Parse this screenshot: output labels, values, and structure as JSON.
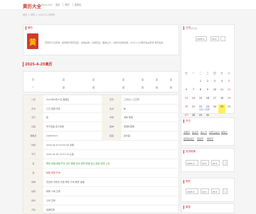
{
  "header": {
    "logo": "黄历大全",
    "logo_sub": "tlbco.com",
    "nav": [
      "首页",
      "黄历",
      "老黄历"
    ]
  },
  "breadcrumb": "首页 > 黄历 > 2025-4-25黄历",
  "intro": {
    "title": "黄历",
    "badge": "黄",
    "text": "老黄历今日查询，提供每日黄历宜忌、吉神凶煞、彭祖百忌、胎神占方、冲煞方位等内容，2025-4-25黄历吉凶查询 黄历宜忌"
  },
  "day_title": "2025-4-25黄历",
  "week_grid": {
    "row1": [
      "宜",
      "宜",
      "宜",
      "宜",
      "宜",
      "宜",
      "宜",
      "宜"
    ],
    "row2": [
      "忌",
      "忌",
      "忌",
      "忌",
      "忌",
      "忌",
      "忌",
      "忌"
    ],
    "head": [
      "日",
      "一",
      "二",
      "三",
      "四",
      "五",
      "六",
      "日"
    ]
  },
  "detail": {
    "rows": [
      {
        "label": "公历",
        "value": "2025年4月25日 星期五",
        "label2": "农历",
        "value2": "三月廿八 乙巳年"
      },
      {
        "label": "岁次",
        "value": "乙巳 庚辰 辛亥",
        "label2": "生肖",
        "value2": "蛇"
      },
      {
        "label": "五行",
        "value": "金",
        "label2": "冲煞",
        "value2": "冲蛇 煞西"
      },
      {
        "label": "彭祖",
        "value": "辛不合酱 亥不嫁娶",
        "label2": "胎神",
        "value2": "床栖外西南"
      },
      {
        "label": "儒略日",
        "value": "2460790.5",
        "label2": "星座",
        "value2": "金牛座"
      },
      {
        "label": "时辰",
        "value": "2025-04-10 03:55:58 清明"
      },
      {
        "label": "节气",
        "value": "2025-05-05 13:57:18 立夏"
      },
      {
        "label": "宜",
        "value": "祭祀 祈福 求嗣 开光 出行 解除 伐木 拆卸 修造 动土 起基 安床 入宅"
      },
      {
        "label": "忌",
        "value": "嫁娶 安葬 开市"
      },
      {
        "label": "吉神",
        "value": "天德合 月德合 天恩 母仓 不将 敬安 金堂"
      },
      {
        "label": "凶煞",
        "value": "劫煞 小耗 五离"
      },
      {
        "label": "吉时",
        "value": "子时 丑时"
      },
      {
        "label": "方位",
        "value": "喜神东南"
      }
    ]
  },
  "calendar": {
    "title": "日历",
    "subtitle": "农历查询",
    "year": "2025",
    "month": "04",
    "weekdays": [
      "日",
      "一",
      "二",
      "三",
      "四",
      "五",
      "六"
    ],
    "days": [
      [
        "",
        "",
        "1",
        "2",
        "3",
        "4",
        "5"
      ],
      [
        "6",
        "7",
        "8",
        "9",
        "10",
        "11",
        "12"
      ],
      [
        "13",
        "14",
        "15",
        "16",
        "17",
        "18",
        "19"
      ],
      [
        "20",
        "21",
        "22",
        "23",
        "24",
        "25",
        "26"
      ],
      [
        "27",
        "28",
        "29",
        "30",
        "",
        "",
        ""
      ]
    ],
    "today": "25",
    "footer": "今日 | 农历"
  },
  "jieri": {
    "title": "节日",
    "items": [
      "清明节",
      "复活节",
      "愚人节",
      "世界卫生日",
      "地球日",
      "世界读书日",
      "劳动节",
      "青年节"
    ]
  },
  "nl1": {
    "title": "农历转换",
    "year": "2025",
    "month": "04",
    "day": "25"
  },
  "nl2": {
    "title": "阴历",
    "year": "2025",
    "month": "04",
    "day": "25"
  },
  "nl3": {
    "title": "星座"
  }
}
